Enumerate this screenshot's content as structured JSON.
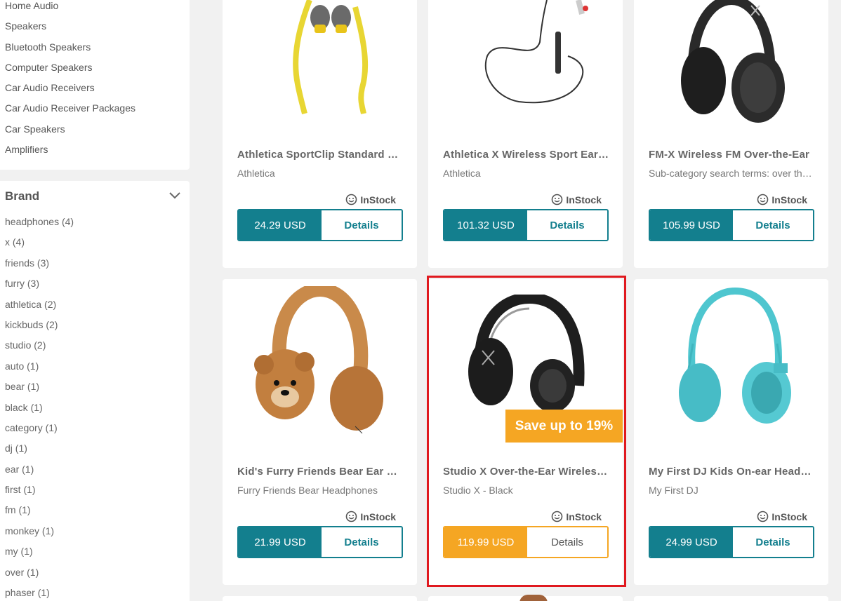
{
  "sidebar": {
    "categories": [
      "Home Audio",
      "Speakers",
      "Bluetooth Speakers",
      "Computer Speakers",
      "Car Audio Receivers",
      "Car Audio Receiver Packages",
      "Car Speakers",
      "Amplifiers"
    ],
    "brand": {
      "title": "Brand",
      "items": [
        "headphones (4)",
        "x (4)",
        "friends (3)",
        "furry (3)",
        "athletica (2)",
        "kickbuds (2)",
        "studio (2)",
        "auto (1)",
        "bear (1)",
        "black (1)",
        "category (1)",
        "dj (1)",
        "ear (1)",
        "first (1)",
        "fm (1)",
        "monkey (1)",
        "my (1)",
        "over (1)",
        "phaser (1)"
      ]
    }
  },
  "products": [
    {
      "name": "Athletica SportClip Standard Earbuds",
      "sub": "Athletica",
      "stock": "InStock",
      "price": "24.29 USD",
      "details": "Details",
      "image": "yellow-sport-earbuds"
    },
    {
      "name": "Athletica X Wireless Sport Earbuds",
      "sub": "Athletica",
      "stock": "InStock",
      "price": "101.32 USD",
      "details": "Details",
      "image": "wireless-sport-earbuds"
    },
    {
      "name": "FM-X Wireless FM Over-the-Ear",
      "sub": "Sub-category search terms: over the ear",
      "stock": "InStock",
      "price": "105.99 USD",
      "details": "Details",
      "image": "black-fm-headphones"
    },
    {
      "name": "Kid's Furry Friends Bear Ear Headphones",
      "sub": "Furry Friends Bear Headphones",
      "stock": "InStock",
      "price": "21.99 USD",
      "details": "Details",
      "image": "bear-headphones"
    },
    {
      "name": "Studio X Over-the-Ear Wireless Headphones",
      "sub": "Studio X - Black",
      "stock": "InStock",
      "price": "119.99 USD",
      "details": "Details",
      "image": "studio-x-headphones",
      "badge": "Save up to 19%"
    },
    {
      "name": "My First DJ Kids On-ear Headphones",
      "sub": "My First DJ",
      "stock": "InStock",
      "price": "24.99 USD",
      "details": "Details",
      "image": "teal-kids-headphones"
    }
  ],
  "colors": {
    "accent": "#137f8e",
    "sale": "#f5a623",
    "highlight": "#e0191f"
  }
}
